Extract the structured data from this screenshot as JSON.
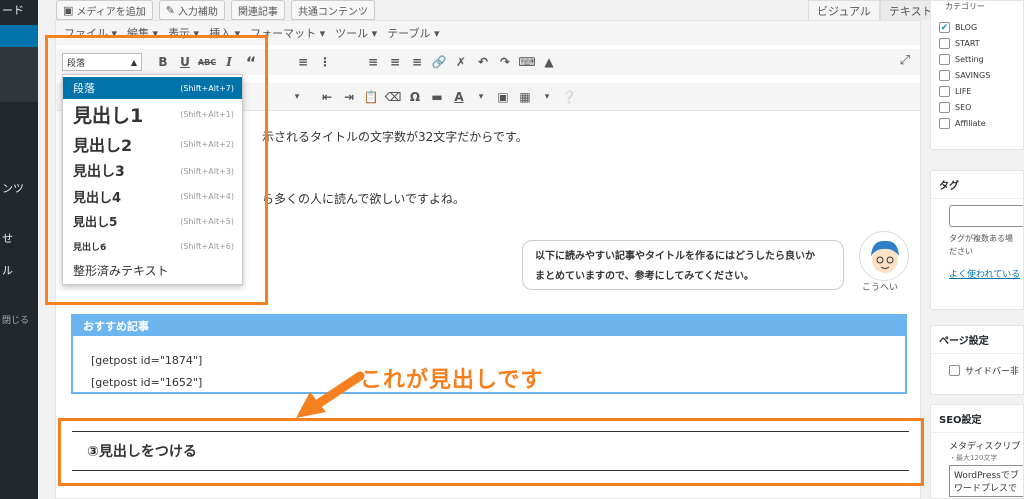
{
  "admin_menu": {
    "items": [
      "ード",
      "ンツ",
      "せ",
      "ル",
      "閉じる"
    ]
  },
  "top_buttons": [
    {
      "label": "メディアを追加",
      "icon": "media-icon"
    },
    {
      "label": "入力補助",
      "icon": "pencil-icon"
    },
    {
      "label": "関連記事",
      "icon": ""
    },
    {
      "label": "共通コンテンツ",
      "icon": ""
    }
  ],
  "editor_tabs": {
    "visual": "ビジュアル",
    "text": "テキスト"
  },
  "menubar": [
    "ファイル ▾",
    "編集 ▾",
    "表示 ▾",
    "挿入 ▾",
    "フォーマット ▾",
    "ツール ▾",
    "テーブル ▾"
  ],
  "format_select": {
    "value": "段落"
  },
  "dropdown": {
    "items": [
      {
        "label": "段落",
        "shortcut": "(Shift+Alt+7)"
      },
      {
        "label": "見出し1",
        "shortcut": "(Shift+Alt+1)"
      },
      {
        "label": "見出し2",
        "shortcut": "(Shift+Alt+2)"
      },
      {
        "label": "見出し3",
        "shortcut": "(Shift+Alt+3)"
      },
      {
        "label": "見出し4",
        "shortcut": "(Shift+Alt+4)"
      },
      {
        "label": "見出し5",
        "shortcut": "(Shift+Alt+5)"
      },
      {
        "label": "見出し6",
        "shortcut": "(Shift+Alt+6)"
      },
      {
        "label": "整形済みテキスト",
        "shortcut": ""
      }
    ]
  },
  "content": {
    "line1": "示されるタイトルの文字数が32文字だからです。",
    "line2": "ら多くの人に読んで欲しいですよね。",
    "bubble_line1": "以下に読みやすい記事やタイトルを作るにはどうしたら良いか",
    "bubble_line2": "まとめていますので、参考にしてみてください。",
    "avatar_name": "こうへい",
    "rec_title": "おすすめ記事",
    "getpost1": "[getpost id=\"1874\"]",
    "getpost2": "[getpost id=\"1652\"]",
    "heading": "③見出しをつける"
  },
  "annotation": {
    "text": "これが見出しです",
    "color": "#f4801f"
  },
  "right_col": {
    "category_header": "カテゴリー",
    "categories": [
      {
        "label": "BLOG",
        "checked": true
      },
      {
        "label": "START",
        "checked": false
      },
      {
        "label": "Setting",
        "checked": false
      },
      {
        "label": "SAVINGS",
        "checked": false
      },
      {
        "label": "LIFE",
        "checked": false
      },
      {
        "label": "SEO",
        "checked": false
      },
      {
        "label": "Affiliate",
        "checked": false
      }
    ],
    "tags_title": "タグ",
    "tags_help": "タグが複数ある場",
    "tags_help2": "ださい",
    "tags_link": "よく使われている",
    "page_settings_title": "ページ設定",
    "sidebar_option": "サイドバー非",
    "seo_title": "SEO設定",
    "meta_label": "メタディスクリプ",
    "meta_hint": "・最大120文字",
    "meta_value": "WordPressでブ",
    "meta_value2": "ワードプレスで"
  }
}
